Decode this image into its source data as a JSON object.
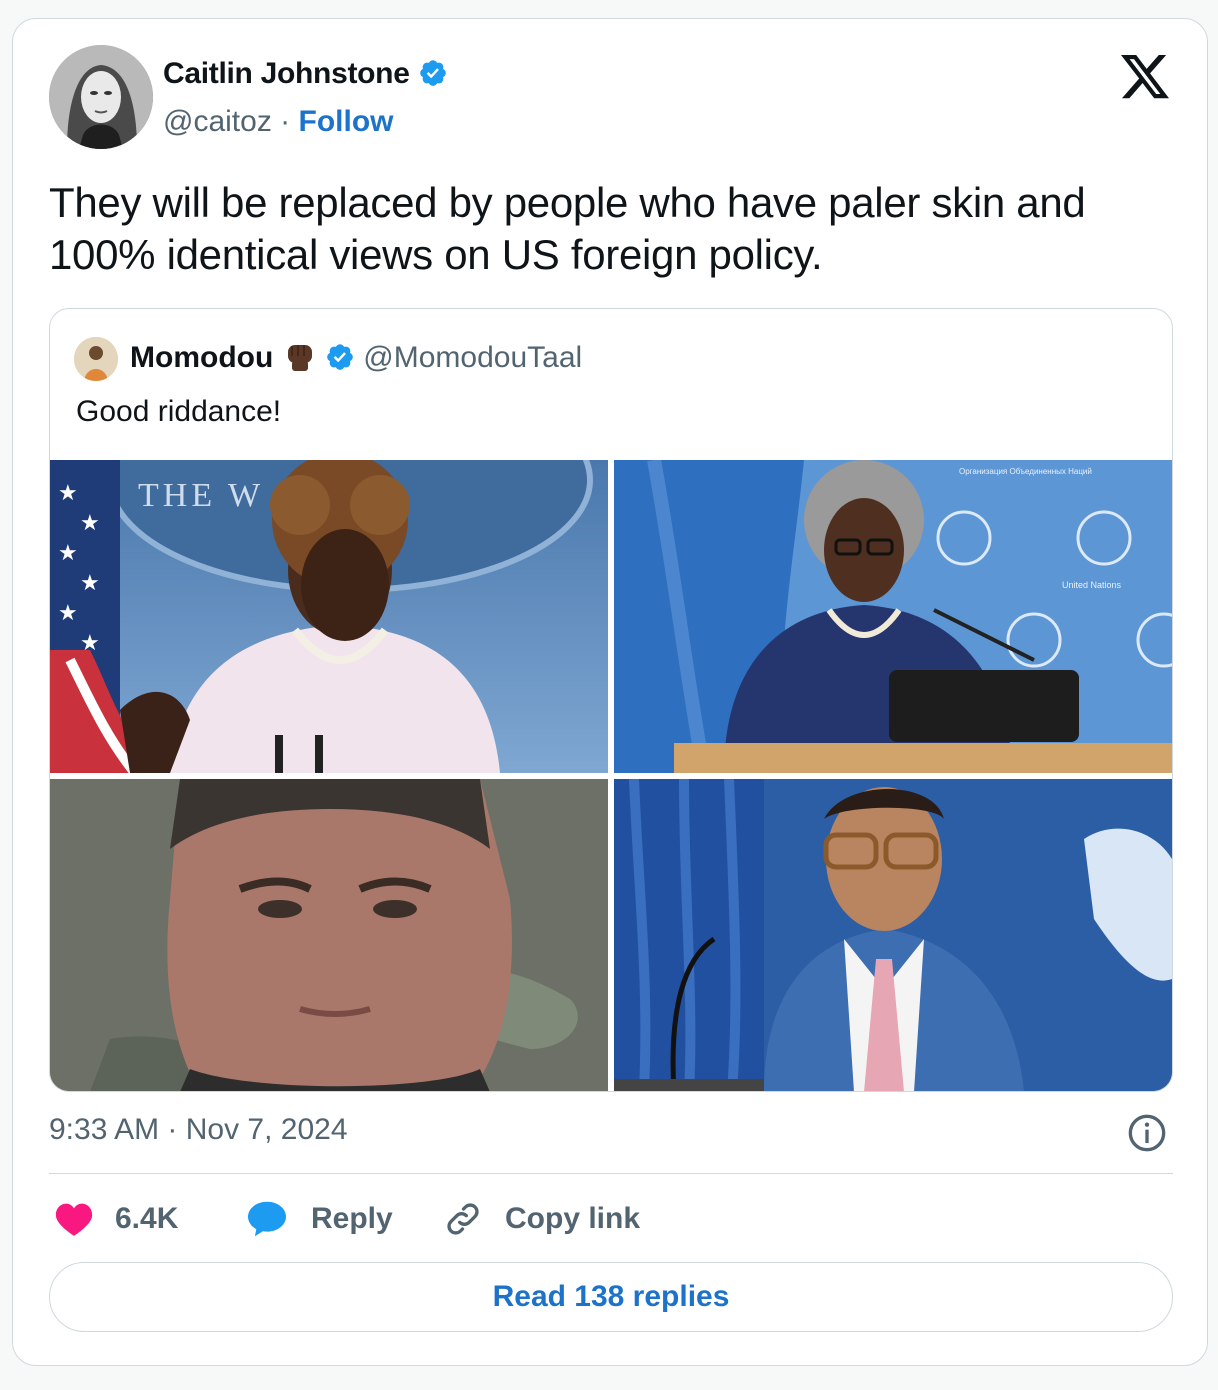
{
  "tweet": {
    "author_name": "Caitlin Johnstone",
    "author_handle": "@caitoz",
    "separator": "·",
    "follow_label": "Follow",
    "text": "They will be replaced by people who have paler skin and 100% identical views on US foreign policy.",
    "timestamp": "9:33 AM · Nov 7, 2024",
    "likes": "6.4K",
    "reply_label": "Reply",
    "copy_link_label": "Copy link",
    "read_replies_label": "Read 138 replies"
  },
  "quoted": {
    "author_name": "Momodou",
    "author_handle": "@MomodouTaal",
    "text": "Good riddance!"
  },
  "photos": {
    "p1_sign": "THE W     OUSE",
    "p2_small_text": "Организация Объединенных Наций",
    "p2_un_text": "United Nations"
  },
  "colors": {
    "link": "#1d73c9",
    "verified": "#1d9bf0",
    "like": "#f91880",
    "reply_icon": "#1d9bf0",
    "muted": "#536471"
  },
  "icons": [
    "verified-badge-icon",
    "x-logo-icon",
    "fist-emoji-icon",
    "heart-icon",
    "reply-bubble-icon",
    "link-icon",
    "info-icon"
  ]
}
